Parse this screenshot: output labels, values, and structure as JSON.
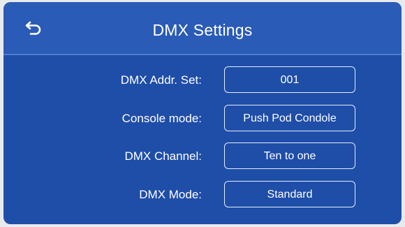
{
  "header": {
    "title": "DMX Settings",
    "back_icon": "back-arrow-icon"
  },
  "settings": [
    {
      "label": "DMX Addr. Set:",
      "value": "001"
    },
    {
      "label": "Console mode:",
      "value": "Push Pod Condole"
    },
    {
      "label": "DMX Channel:",
      "value": "Ten to one"
    },
    {
      "label": "DMX Mode:",
      "value": "Standard"
    }
  ],
  "colors": {
    "background": "#1f4ea8",
    "header": "#2a5bb6",
    "text": "#ffffff"
  }
}
